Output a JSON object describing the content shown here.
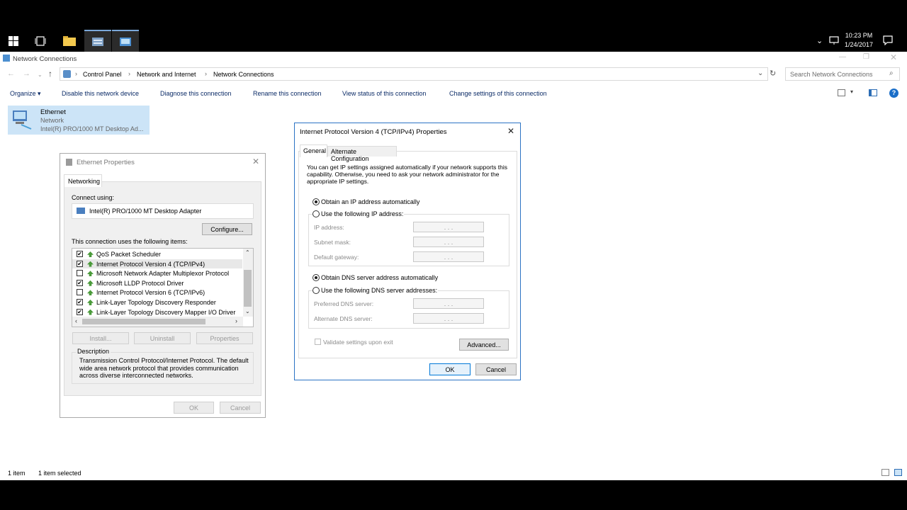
{
  "taskbar": {
    "time": "10:23 PM",
    "date": "1/24/2017"
  },
  "explorer": {
    "title": "Network Connections",
    "breadcrumb": [
      "Control Panel",
      "Network and Internet",
      "Network Connections"
    ],
    "search_placeholder": "Search Network Connections",
    "commands": [
      "Organize ▾",
      "Disable this network device",
      "Diagnose this connection",
      "Rename this connection",
      "View status of this connection",
      "Change settings of this connection"
    ],
    "adapter": {
      "name": "Ethernet",
      "status": "Network",
      "device": "Intel(R) PRO/1000 MT Desktop Ad..."
    },
    "status": {
      "items": "1 item",
      "selected": "1 item selected"
    }
  },
  "eth": {
    "title": "Ethernet Properties",
    "tab": "Networking",
    "connect_using_label": "Connect using:",
    "adapter_name": "Intel(R) PRO/1000 MT Desktop Adapter",
    "configure": "Configure...",
    "items_label": "This connection uses the following items:",
    "items": [
      {
        "label": "QoS Packet Scheduler",
        "checked": true
      },
      {
        "label": "Internet Protocol Version 4 (TCP/IPv4)",
        "checked": true
      },
      {
        "label": "Microsoft Network Adapter Multiplexor Protocol",
        "checked": false
      },
      {
        "label": "Microsoft LLDP Protocol Driver",
        "checked": true
      },
      {
        "label": "Internet Protocol Version 6 (TCP/IPv6)",
        "checked": false
      },
      {
        "label": "Link-Layer Topology Discovery Responder",
        "checked": true
      },
      {
        "label": "Link-Layer Topology Discovery Mapper I/O Driver",
        "checked": true
      }
    ],
    "install": "Install...",
    "uninstall": "Uninstall",
    "properties": "Properties",
    "description_label": "Description",
    "description": "Transmission Control Protocol/Internet Protocol. The default wide area network protocol that provides communication across diverse interconnected networks.",
    "ok": "OK",
    "cancel": "Cancel"
  },
  "ipv4": {
    "title": "Internet Protocol Version 4 (TCP/IPv4) Properties",
    "tab_general": "General",
    "tab_alt": "Alternate Configuration",
    "intro": "You can get IP settings assigned automatically if your network supports this capability. Otherwise, you need to ask your network administrator for the appropriate IP settings.",
    "obtain_ip": "Obtain an IP address automatically",
    "use_ip": "Use the following IP address:",
    "ip_address": "IP address:",
    "subnet_mask": "Subnet mask:",
    "default_gateway": "Default gateway:",
    "obtain_dns": "Obtain DNS server address automatically",
    "use_dns": "Use the following DNS server addresses:",
    "preferred_dns": "Preferred DNS server:",
    "alternate_dns": "Alternate DNS server:",
    "validate": "Validate settings upon exit",
    "advanced": "Advanced...",
    "ok": "OK",
    "cancel": "Cancel",
    "ip_dots": ". . ."
  }
}
